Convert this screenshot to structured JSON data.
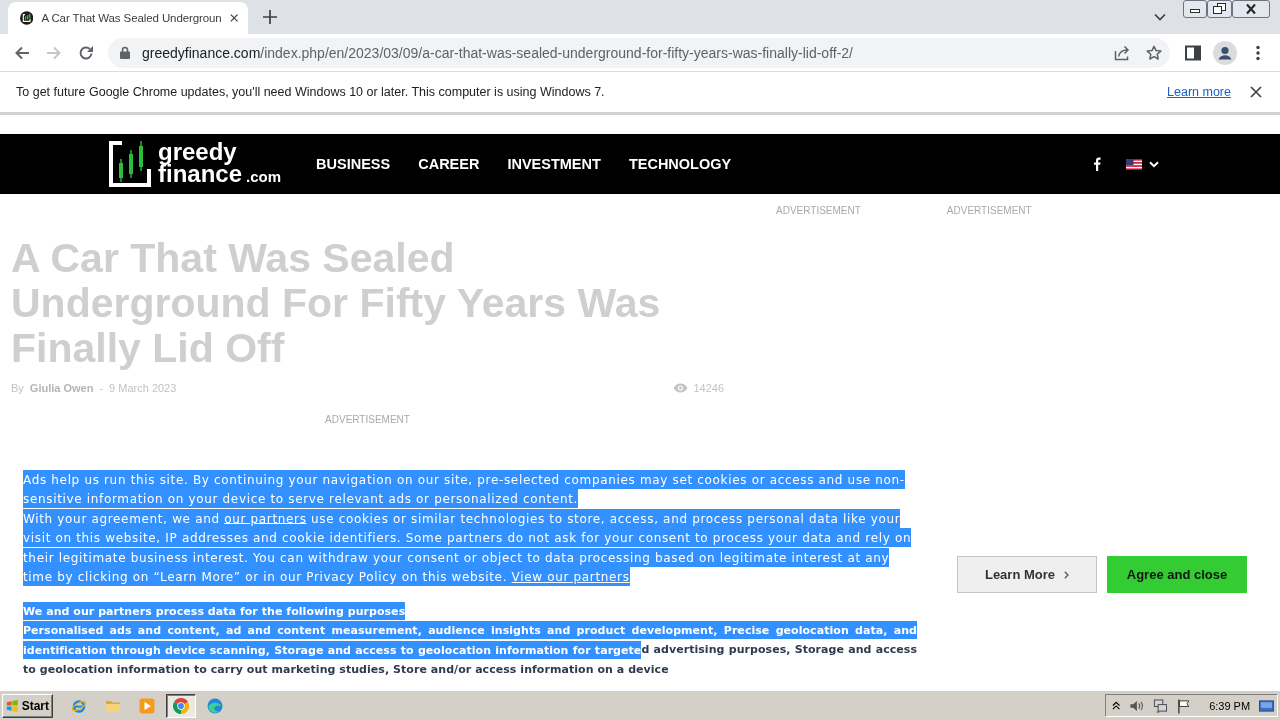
{
  "browser": {
    "tabs": [
      {
        "title": "A Car That Was Sealed Undergroun",
        "selected": true
      }
    ],
    "nav_buttons": [
      {
        "kind": "back",
        "disabled": false
      },
      {
        "kind": "forward",
        "disabled": true
      },
      {
        "kind": "reload",
        "disabled": false
      }
    ],
    "address": {
      "domain": "greedyfinance.com",
      "path": "/index.php/en/2023/03/09/a-car-that-was-sealed-underground-for-fifty-years-was-finally-lid-off-2/"
    },
    "infobar": {
      "message": "To get future Google Chrome updates, you'll need Windows 10 or later. This computer is using Windows 7.",
      "link": "Learn more"
    }
  },
  "site": {
    "logo": {
      "line_1": "greedy",
      "line_2": "finance",
      "suffix": ".com"
    },
    "nav": [
      {
        "label": "BUSINESS"
      },
      {
        "label": "CAREER"
      },
      {
        "label": "INVESTMENT"
      },
      {
        "label": "TECHNOLOGY"
      }
    ],
    "sidebar_ads": [
      "ADVERTISEMENT",
      "ADVERTISEMENT"
    ],
    "article": {
      "title": "A Car That Was Sealed Underground For Fifty Years Was Finally Lid Off",
      "byline": {
        "prefix": "By",
        "author": "Giulia Owen",
        "separator": "-",
        "date": "9 March 2023"
      },
      "views": "14246",
      "ad_label": "ADVERTISEMENT"
    }
  },
  "consent": {
    "blocks": [
      {
        "kind": "notice",
        "paragraphs": [
          {
            "segments": [
              {
                "kind": "text",
                "text": "Ads help us run this site. By continuing your navigation on our site, pre-selected companies may set cookies or access and use non-sensitive information on your device to serve relevant ads or personalized content.",
                "selected": true
              }
            ]
          },
          {
            "segments": [
              {
                "kind": "text",
                "text": "With your agreement, we and ",
                "selected": true
              },
              {
                "kind": "link",
                "text": "our partners",
                "selected": true
              },
              {
                "kind": "text",
                "text": " use cookies or similar technologies to store, access, and process personal data like your visit on this website, IP addresses and cookie identifiers. Some partners do not ask for your consent to process your data and rely on their legitimate business interest. You can withdraw your consent or object to data processing based on legitimate interest at any time by clicking on “Learn More” or in our Privacy Policy on this website. ",
                "selected": true
              },
              {
                "kind": "link",
                "text": "View our partners",
                "selected": true
              }
            ]
          }
        ]
      },
      {
        "kind": "purposes",
        "paragraphs": [
          {
            "segments": [
              {
                "kind": "text",
                "text": "We and our partners process data for the following purposes",
                "selected": true
              }
            ]
          },
          {
            "segments": [
              {
                "kind": "text",
                "text": "Personalised ads and content, ad and content measurement, audience insights and product development, Precise geolocation data, and identification through device scanning, Storage and access to geolocation information for targete",
                "selected": true
              },
              {
                "kind": "text",
                "text": "d advertising purposes, Storage and access to geolocation information to carry out marketing studies, Store and/or access information on a device",
                "selected": false
              }
            ]
          }
        ]
      }
    ],
    "buttons": [
      {
        "label": "Learn More",
        "kind": "secondary"
      },
      {
        "label": "Agree and close",
        "kind": "primary"
      }
    ]
  },
  "taskbar": {
    "start": "Start",
    "apps": [
      {
        "kind": "ie",
        "selected": false
      },
      {
        "kind": "folder",
        "selected": false
      },
      {
        "kind": "player",
        "selected": false
      },
      {
        "kind": "chrome",
        "selected": true
      },
      {
        "kind": "edge",
        "selected": false
      }
    ],
    "clock": "6:39 PM"
  }
}
